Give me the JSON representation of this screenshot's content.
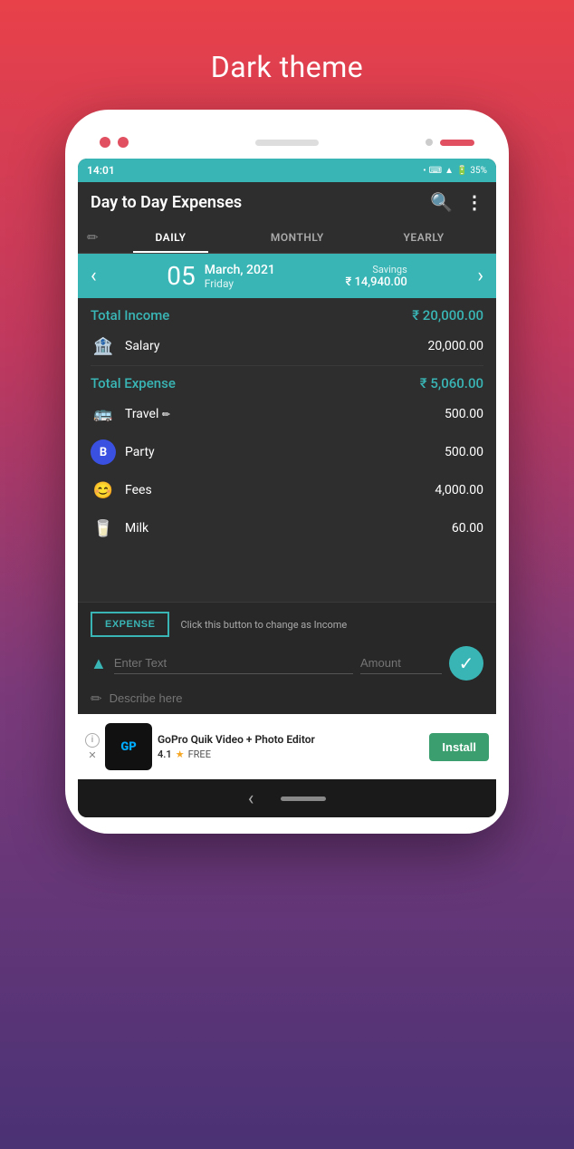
{
  "page": {
    "title": "Dark theme",
    "background_gradient": [
      "#e8414a",
      "#c0395e",
      "#7b3a7a",
      "#4a3275"
    ]
  },
  "status_bar": {
    "time": "14:01",
    "battery": "35%",
    "signal_icons": "• ⌨ ▲ ✕ R"
  },
  "app_bar": {
    "title": "Day to Day Expenses",
    "search_label": "search",
    "more_label": "more"
  },
  "tabs": [
    {
      "label": "DAILY",
      "active": true
    },
    {
      "label": "MONTHLY",
      "active": false
    },
    {
      "label": "YEARLY",
      "active": false
    }
  ],
  "date_nav": {
    "day": "05",
    "month_year": "March, 2021",
    "weekday": "Friday",
    "savings_label": "Savings",
    "savings_amount": "₹ 14,940.00"
  },
  "income": {
    "section_title": "Total Income",
    "section_amount": "₹ 20,000.00",
    "items": [
      {
        "icon": "bank",
        "name": "Salary",
        "amount": "20,000.00"
      }
    ]
  },
  "expense": {
    "section_title": "Total Expense",
    "section_amount": "₹ 5,060.00",
    "items": [
      {
        "icon": "car",
        "name": "Travel",
        "has_edit": true,
        "amount": "500.00"
      },
      {
        "icon": "party",
        "name": "Party",
        "has_edit": false,
        "amount": "500.00"
      },
      {
        "icon": "fees",
        "name": "Fees",
        "has_edit": false,
        "amount": "4,000.00"
      },
      {
        "icon": "milk",
        "name": "Milk",
        "has_edit": false,
        "amount": "60.00"
      }
    ]
  },
  "bottom_form": {
    "expense_btn_label": "EXPENSE",
    "toggle_hint": "Click this button to change as Income",
    "text_placeholder": "Enter Text",
    "amount_placeholder": "Amount",
    "describe_placeholder": "Describe here",
    "confirm_icon": "✓"
  },
  "ad": {
    "title": "GoPro Quik Video + Photo Editor",
    "rating": "4.1",
    "stars": "★",
    "free_label": "FREE",
    "install_label": "Install"
  },
  "nav_bar": {
    "back": "‹"
  }
}
